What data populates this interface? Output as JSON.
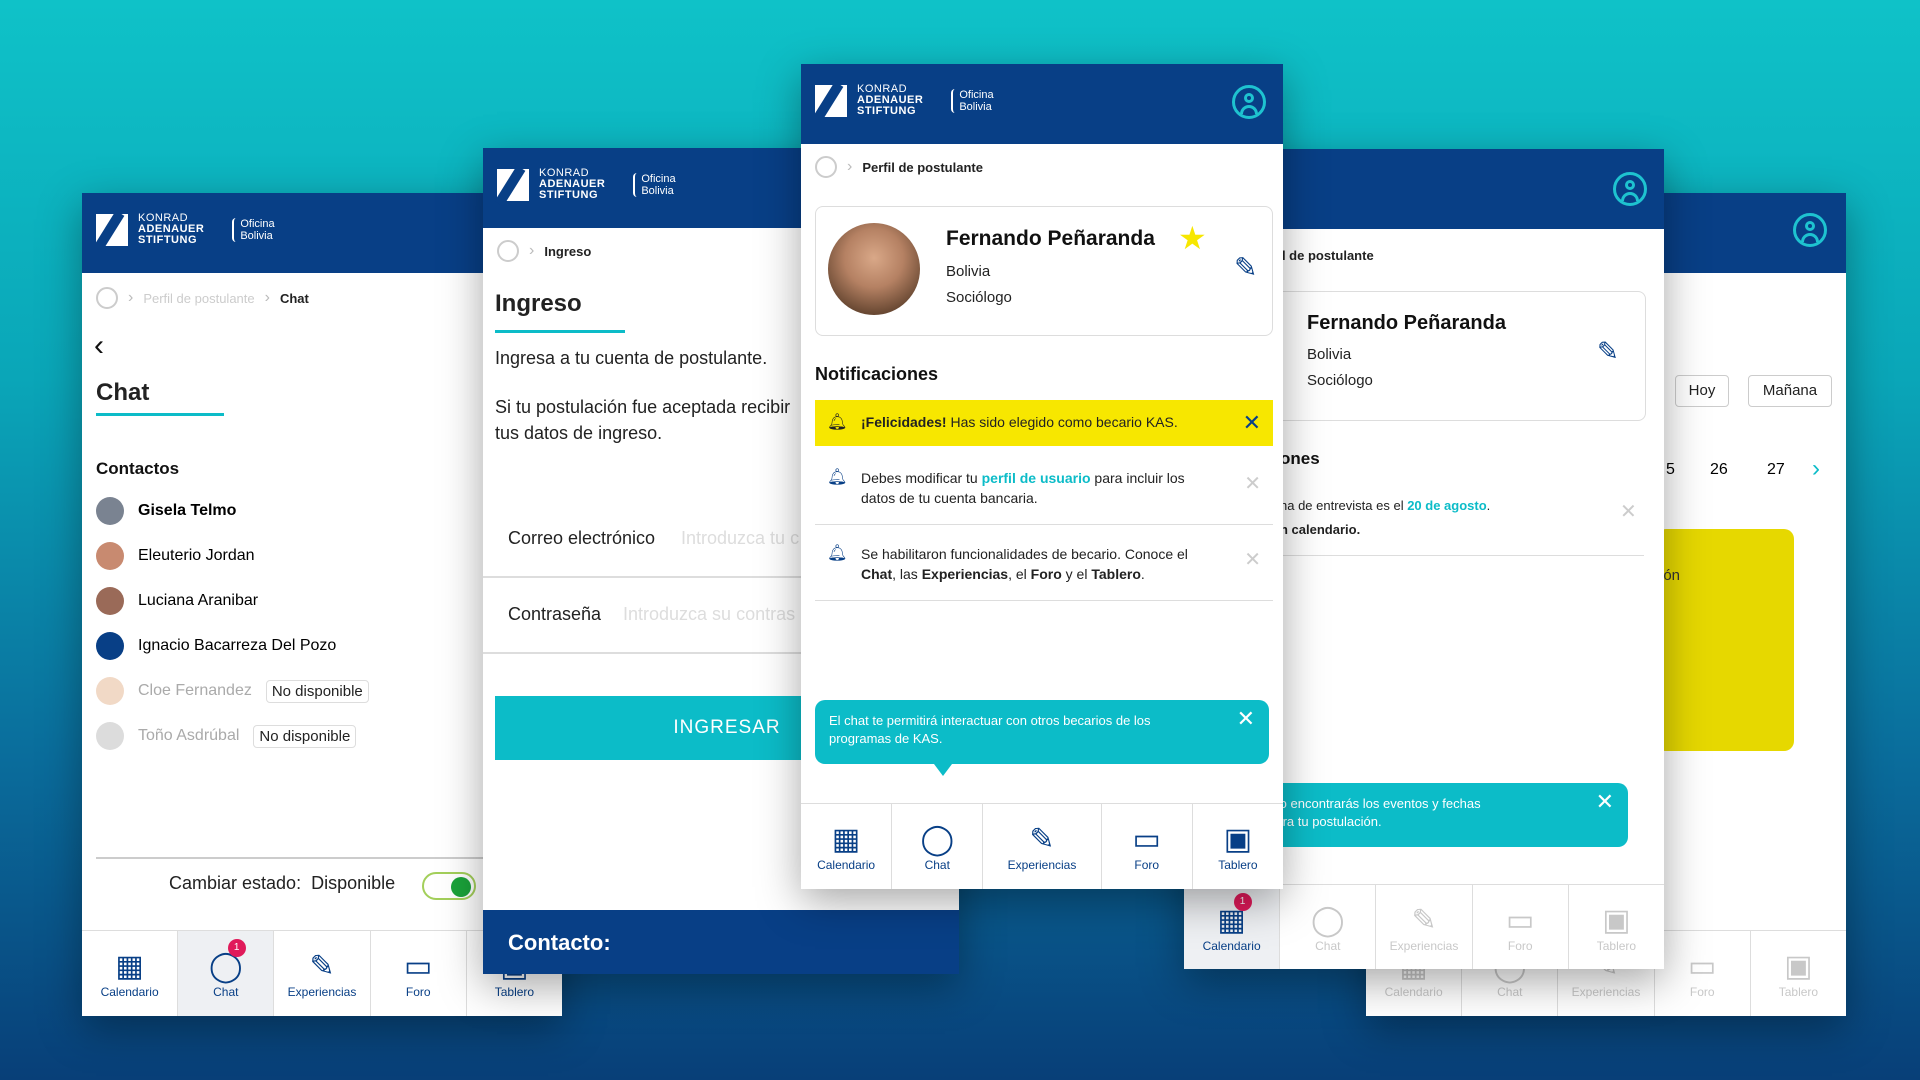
{
  "brand": {
    "kas_line1": "KONRAD",
    "kas_line2": "ADENAUER",
    "kas_line3": "STIFTUNG",
    "office_line1": "Oficina",
    "office_line2": "Bolivia"
  },
  "chat_screen": {
    "crumb_prev": "Perfil de postulante",
    "crumb_current": "Chat",
    "title": "Chat",
    "contacts_heading": "Contactos",
    "contacts": [
      {
        "name": "Gisela Telmo",
        "bold": true,
        "status": ""
      },
      {
        "name": "Eleuterio Jordan",
        "status": ""
      },
      {
        "name": "Luciana Aranibar",
        "status": ""
      },
      {
        "name": "Ignacio Bacarreza Del Pozo",
        "status": ""
      },
      {
        "name": "Cloe Fernandez",
        "status": "No disponible"
      },
      {
        "name": "Toño Asdrúbal",
        "status": "No disponible"
      }
    ],
    "status_label": "Cambiar estado:",
    "status_value": "Disponible"
  },
  "login_screen": {
    "crumb_current": "Ingreso",
    "title": "Ingreso",
    "intro1": "Ingresa a tu cuenta de postulante.",
    "intro2": "Si tu postulación fue aceptada recibir",
    "intro3": "tus datos de ingreso.",
    "email_label": "Correo electrónico",
    "email_placeholder": "Introduzca tu c",
    "password_label": "Contraseña",
    "password_placeholder": "Introduzca su contras",
    "submit": "INGRESAR",
    "footer": "Contacto:"
  },
  "profile_screen": {
    "crumb_current": "Perfil de postulante",
    "name": "Fernando Peñaranda",
    "country": "Bolivia",
    "role": "Sociólogo",
    "notif_heading": "Notificaciones",
    "notif1_bold": "¡Felicidades!",
    "notif1_text": "Has sido elegido como becario KAS.",
    "notif2_a": "Debes modificar tu",
    "notif2_link": "perfil de usuario",
    "notif2_b": "para incluir los",
    "notif2_c": "datos de tu cuenta bancaria.",
    "notif3_a": "Se habilitaron funcionalidades de becario. Conoce el",
    "notif3_chat": "Chat",
    "notif3_b": ", las",
    "notif3_exp": "Experiencias",
    "notif3_c": ", el",
    "notif3_foro": "Foro",
    "notif3_d": "y el",
    "notif3_tab": "Tablero",
    "tip": "El chat te permitirá interactuar con otros becarios de los programas de KAS."
  },
  "right_screen": {
    "crumb_current": "fil de postulante",
    "name": "Fernando Peñaranda",
    "country": "Bolivia",
    "role": "Sociólogo",
    "notif_heading": "ones",
    "notif_a": "ha de entrevista es el",
    "notif_link": "20 de agosto",
    "notif_b": "n calendario.",
    "tip_a": "dario encontrarás los eventos y fechas",
    "tip_b": "s para tu postulación."
  },
  "far_right_screen": {
    "btn_today": "Hoy",
    "btn_tomorrow": "Mañana",
    "day_a": "5",
    "day_b": "26",
    "day_c": "27",
    "event_text": "ión"
  },
  "tabs": {
    "calendar": "Calendario",
    "chat": "Chat",
    "experiences": "Experiencias",
    "forum": "Foro",
    "board": "Tablero",
    "badge": "1"
  },
  "colors": {
    "navy": "#083f86",
    "teal": "#0cbcc8",
    "yellow": "#f7e700"
  }
}
